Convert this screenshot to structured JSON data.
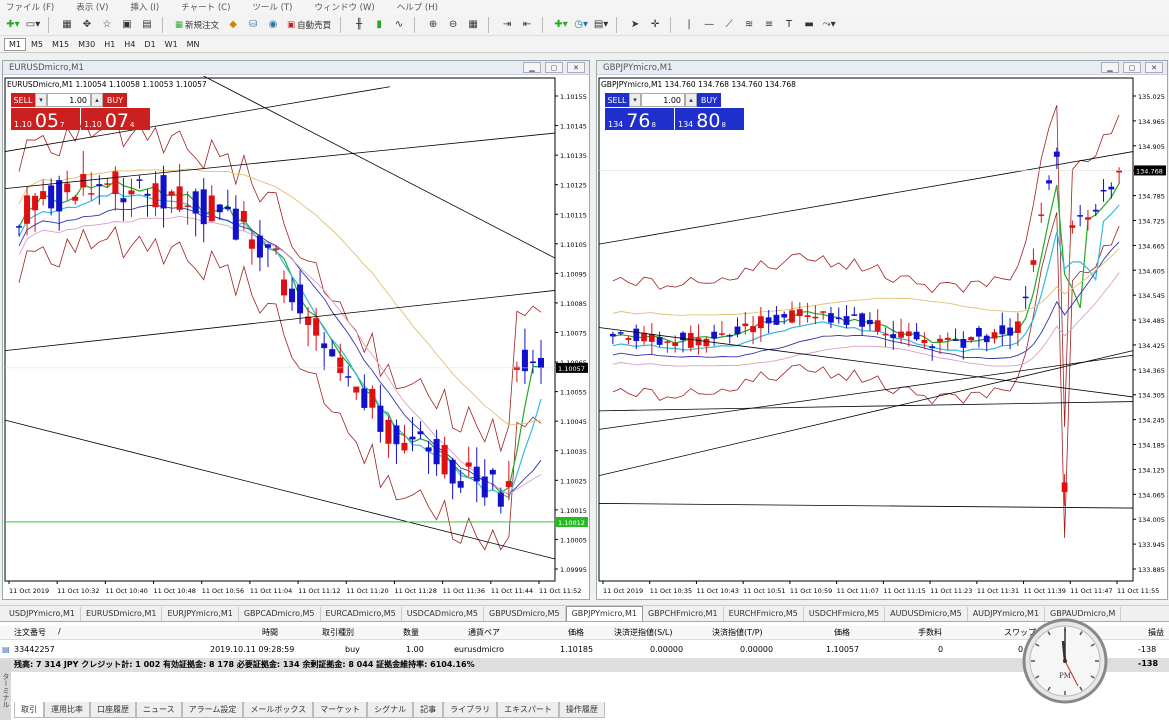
{
  "menu": [
    "ファイル (F)",
    "表示 (V)",
    "挿入 (I)",
    "チャート (C)",
    "ツール (T)",
    "ウィンドウ (W)",
    "ヘルプ (H)"
  ],
  "toolbar": {
    "new_order": "新規注文",
    "auto_trade": "自動売買"
  },
  "timeframes": [
    "M1",
    "M5",
    "M15",
    "M30",
    "H1",
    "H4",
    "D1",
    "W1",
    "MN"
  ],
  "timeframe_selected": "M1",
  "charts": [
    {
      "window_title": "EURUSDmicro,M1",
      "symbol_line": "EURUSDmicro,M1  1.10054 1.10058 1.10053 1.10057",
      "sell_label": "SELL",
      "buy_label": "BUY",
      "volume": "1.00",
      "sell_price_small": "1.10",
      "sell_price_big": "05",
      "sell_price_sup": "7",
      "buy_price_small": "1.10",
      "buy_price_big": "07",
      "buy_price_sup": "4",
      "panel_color": "#cc1f1f",
      "price_labels": [
        "1.10155",
        "1.10145",
        "1.10135",
        "1.10125",
        "1.10115",
        "1.10105",
        "1.10095",
        "1.10085",
        "1.10075",
        "1.10065",
        "1.10055",
        "1.10045",
        "1.10035",
        "1.10025",
        "1.10015",
        "1.10005",
        "1.09995"
      ],
      "current_price": "1.10057",
      "line_price": "1.10012",
      "time_labels": [
        "11 Oct 2019",
        "11 Oct 10:32",
        "11 Oct 10:40",
        "11 Oct 10:48",
        "11 Oct 10:56",
        "11 Oct 11:04",
        "11 Oct 11:12",
        "11 Oct 11:20",
        "11 Oct 11:28",
        "11 Oct 11:36",
        "11 Oct 11:44",
        "11 Oct 11:52"
      ]
    },
    {
      "window_title": "GBPJPYmicro,M1",
      "symbol_line": "GBPJPYmicro,M1  134.760 134.768 134.760 134.768",
      "sell_label": "SELL",
      "buy_label": "BUY",
      "volume": "1.00",
      "sell_price_small": "134",
      "sell_price_big": "76",
      "sell_price_sup": "8",
      "buy_price_small": "134",
      "buy_price_big": "80",
      "buy_price_sup": "8",
      "panel_color": "#1f2fcc",
      "price_labels": [
        "135.025",
        "134.965",
        "134.905",
        "134.845",
        "134.785",
        "134.725",
        "134.665",
        "134.605",
        "134.545",
        "134.485",
        "134.425",
        "134.365",
        "134.305",
        "134.245",
        "134.185",
        "134.125",
        "134.065",
        "134.005",
        "133.945",
        "133.885"
      ],
      "current_price": "134.768",
      "time_labels": [
        "11 Oct 2019",
        "11 Oct 10:35",
        "11 Oct 10:43",
        "11 Oct 10:51",
        "11 Oct 10:59",
        "11 Oct 11:07",
        "11 Oct 11:15",
        "11 Oct 11:23",
        "11 Oct 11:31",
        "11 Oct 11:39",
        "11 Oct 11:47",
        "11 Oct 11:55"
      ]
    }
  ],
  "chart_tabs": [
    "USDJPYmicro,M1",
    "EURUSDmicro,M1",
    "EURJPYmicro,M1",
    "GBPCADmicro,M5",
    "EURCADmicro,M5",
    "USDCADmicro,M5",
    "GBPUSDmicro,M5",
    "GBPJPYmicro,M1",
    "GBPCHFmicro,M1",
    "EURCHFmicro,M5",
    "USDCHFmicro,M5",
    "AUDUSDmicro,M5",
    "AUDJPYmicro,M1",
    "GBPAUDmicro,M"
  ],
  "chart_tab_selected": 7,
  "terminal": {
    "headers": [
      "注文番号",
      "/",
      "時間",
      "取引種別",
      "数量",
      "通貨ペア",
      "価格",
      "決済逆指値(S/L)",
      "決済指値(T/P)",
      "価格",
      "手数料",
      "スワップ",
      "損益"
    ],
    "row": {
      "ticket": "33442257",
      "time": "2019.10.11 09:28:59",
      "type": "buy",
      "volume": "1.00",
      "symbol": "eurusdmicro",
      "open_price": "1.10185",
      "sl": "0.00000",
      "tp": "0.00000",
      "price": "1.10057",
      "commission": "0",
      "swap": "0",
      "profit": "-138"
    },
    "summary": "残高: 7 314 JPY  クレジット計: 1 002  有効証拠金: 8 178  必要証拠金: 134  余剰証拠金: 8 044  証拠金維持率: 6104.16%",
    "summary_profit": "-138",
    "tabs": [
      "取引",
      "運用比率",
      "口座履歴",
      "ニュース",
      "アラーム設定",
      "メールボックス",
      "マーケット",
      "シグナル",
      "記事",
      "ライブラリ",
      "エキスパート",
      "操作履歴"
    ],
    "side_label": "ターミナル"
  },
  "clock_label": "PM"
}
